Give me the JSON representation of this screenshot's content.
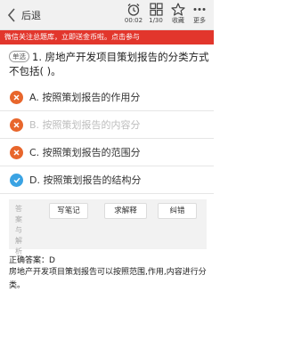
{
  "topbar": {
    "back_label": "后退",
    "timer": "00:02",
    "page": "1/30",
    "favorite_label": "收藏",
    "more_label": "更多"
  },
  "banner": {
    "text": "微信关注总题库，立即送金币啦。点击参与"
  },
  "question": {
    "tag": "单选",
    "text": "1. 房地产开发项目策划报告的分类方式不包括(  )。"
  },
  "options": [
    {
      "text": "A. 按照策划报告的作用分",
      "state": "wrong"
    },
    {
      "text": "B. 按照策划报告的内容分",
      "state": "dim"
    },
    {
      "text": "C. 按照策划报告的范围分",
      "state": "wrong"
    },
    {
      "text": "D. 按照策划报告的结构分",
      "state": "correct"
    }
  ],
  "answer_panel": {
    "side_label": "答案与解析",
    "buttons": [
      "写笔记",
      "求解释",
      "纠错"
    ]
  },
  "result": {
    "text": "正确答案：D"
  },
  "explanation": {
    "text": "房地产开发项目策划报告可以按照范围,作用,内容进行分类。"
  },
  "colors": {
    "banner": "#e2362c",
    "wrong": "#e8662c",
    "correct": "#3aa3e3"
  }
}
